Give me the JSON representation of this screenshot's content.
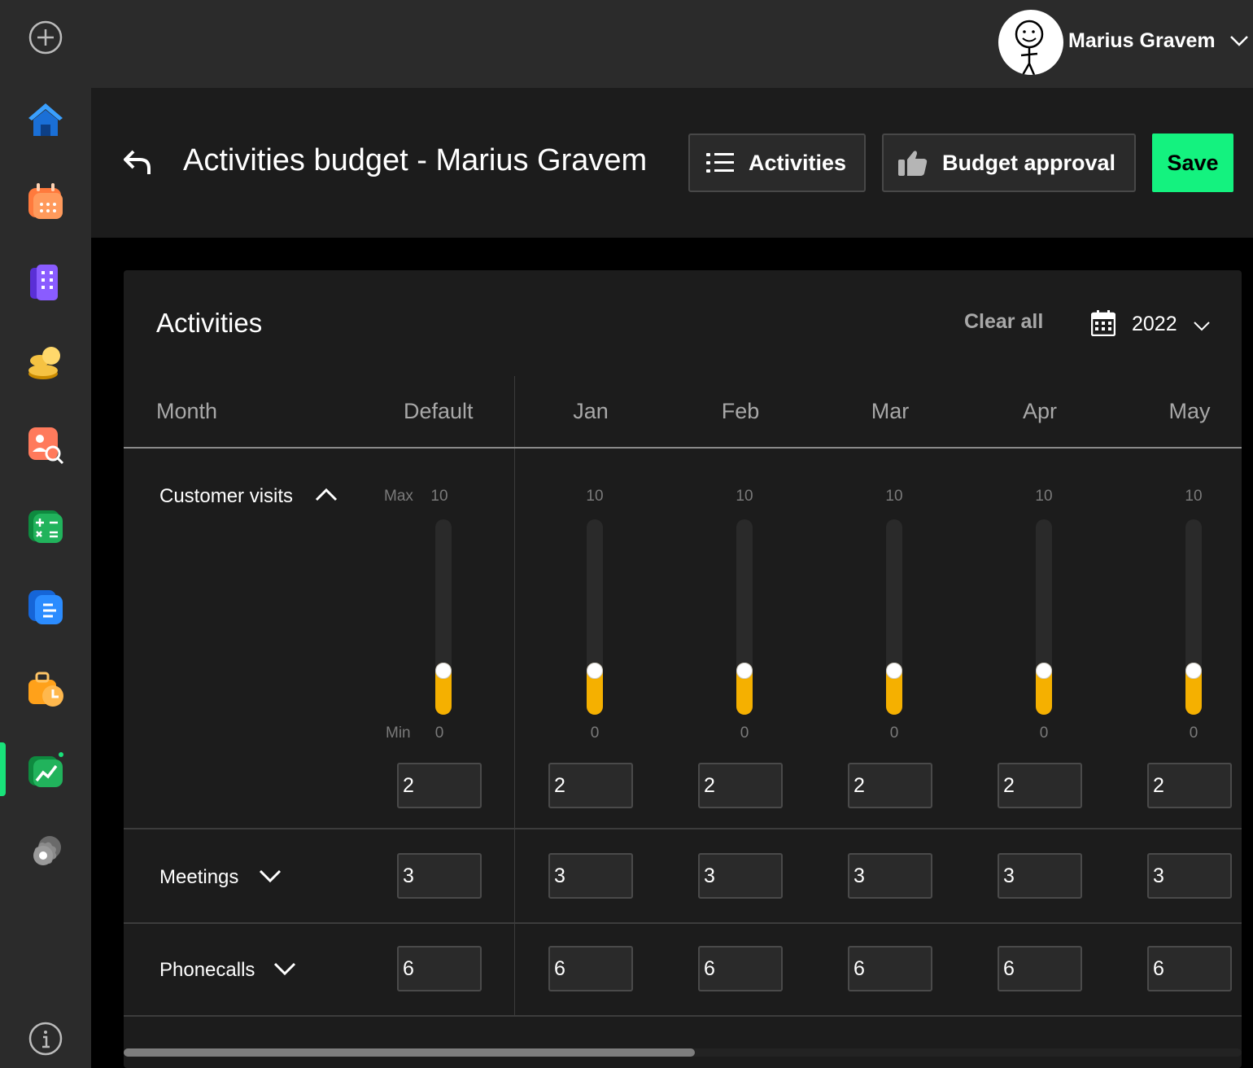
{
  "sidebar": {
    "items": [
      {
        "icon": "add-circle-icon"
      },
      {
        "icon": "home-icon"
      },
      {
        "icon": "calendar-icon"
      },
      {
        "icon": "building-icon"
      },
      {
        "icon": "coins-icon"
      },
      {
        "icon": "contact-search-icon"
      },
      {
        "icon": "calculator-icon"
      },
      {
        "icon": "document-icon"
      },
      {
        "icon": "briefcase-clock-icon"
      },
      {
        "icon": "chart-icon",
        "active": true
      },
      {
        "icon": "gear-icon"
      },
      {
        "icon": "info-icon"
      }
    ],
    "active_color": "#19e27a"
  },
  "user": {
    "name": "Marius Gravem"
  },
  "header": {
    "title": "Activities budget - Marius Gravem",
    "activities_label": "Activities",
    "budget_approval_label": "Budget approval",
    "save_label": "Save",
    "save_color": "#14f27f"
  },
  "card": {
    "title": "Activities",
    "clear_all_label": "Clear all",
    "year": "2022"
  },
  "table": {
    "month_label": "Month",
    "default_label": "Default",
    "months": [
      "Jan",
      "Feb",
      "Mar",
      "Apr",
      "May"
    ],
    "max_label": "Max",
    "min_label": "Min",
    "rows": [
      {
        "label": "Customer visits",
        "expanded": true,
        "max": "10",
        "min": "0",
        "slider_fraction": 0.2,
        "default": "2",
        "values": [
          "2",
          "2",
          "2",
          "2",
          "2"
        ]
      },
      {
        "label": "Meetings",
        "expanded": false,
        "default": "3",
        "values": [
          "3",
          "3",
          "3",
          "3",
          "3"
        ]
      },
      {
        "label": "Phonecalls",
        "expanded": false,
        "default": "6",
        "values": [
          "6",
          "6",
          "6",
          "6",
          "6"
        ]
      }
    ]
  },
  "slider_color": "#f5b000"
}
